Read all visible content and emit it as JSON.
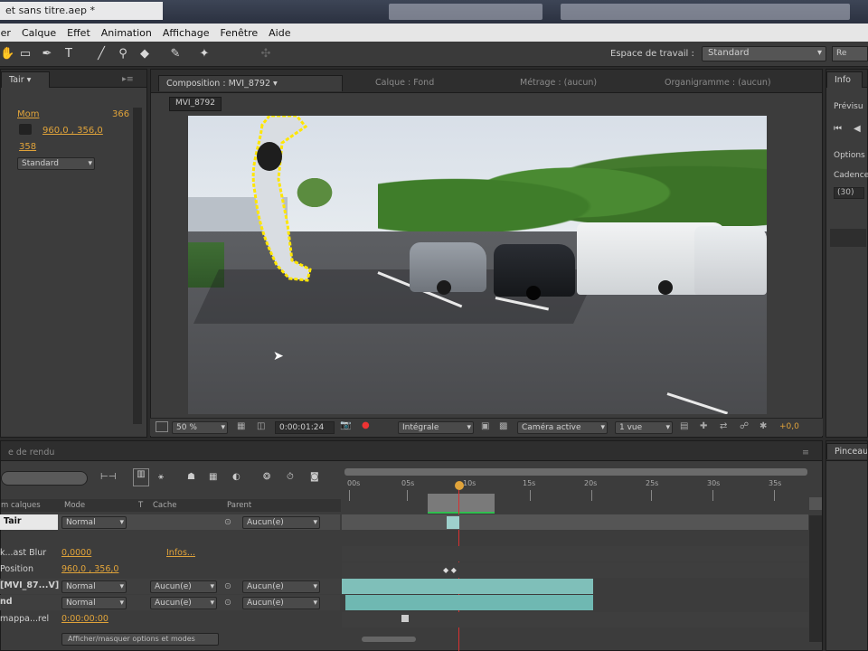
{
  "window": {
    "title": "et sans titre.aep *"
  },
  "menu": [
    "Fichier",
    "Calque",
    "Effet",
    "Animation",
    "Affichage",
    "Fenêtre",
    "Aide"
  ],
  "toolbar": {
    "workspace_label": "Espace de travail :",
    "workspace_value": "Standard",
    "record_label": "Re"
  },
  "left_panel": {
    "tab_label": "Tair",
    "prop_name": "Mom",
    "prop_value": "366",
    "coords": "960,0 , 356,0",
    "value_line": "358",
    "blend_value": "Standard"
  },
  "composition_panel": {
    "tab_composition": "Composition : MVI_8792",
    "tab_layer": "Calque : Fond",
    "tab_footage": "Métrage : (aucun)",
    "tab_flowchart": "Organigramme : (aucun)",
    "breadcrumb": "MVI_8792"
  },
  "viewer_controls": {
    "zoom": "50 %",
    "timecode": "0:00:01:24",
    "resolution": "Intégrale",
    "camera": "Caméra active",
    "views": "1 vue",
    "exposure": "+0,0"
  },
  "info_panel": {
    "tab": "Info",
    "preview_label": "Prévisu",
    "options_label": "Options",
    "cadence_label": "Cadence",
    "cadence_value": "(30)"
  },
  "right_bottom_panel": {
    "tab": "Pinceau"
  },
  "timeline": {
    "panel_label": "e de rendu",
    "search_placeholder": "",
    "col_name": "m calques",
    "col_mode": "Mode",
    "col_t": "T",
    "col_cache": "Cache",
    "col_parent": "Parent",
    "ticks": [
      "00s",
      "05s",
      "10s",
      "15s",
      "20s",
      "25s",
      "30s",
      "35s"
    ],
    "rows": [
      {
        "name": "Tair",
        "mode": "Normal",
        "cache": "",
        "parent": "Aucun(e)"
      },
      {
        "name": "k...ast Blur",
        "value": "0,0000",
        "value2": "Infos..."
      },
      {
        "name": "Position",
        "value": "960,0 , 356,0"
      },
      {
        "name": "[MVI_87...V]",
        "mode": "Normal",
        "cache": "Aucun(e)",
        "parent": "Aucun(e)"
      },
      {
        "name": "nd",
        "mode": "Normal",
        "cache": "Aucun(e)",
        "parent": "Aucun(e)"
      },
      {
        "name": "mappa...rel",
        "value": "0:00:00:00"
      }
    ],
    "footer": "Afficher/masquer options et modes"
  }
}
